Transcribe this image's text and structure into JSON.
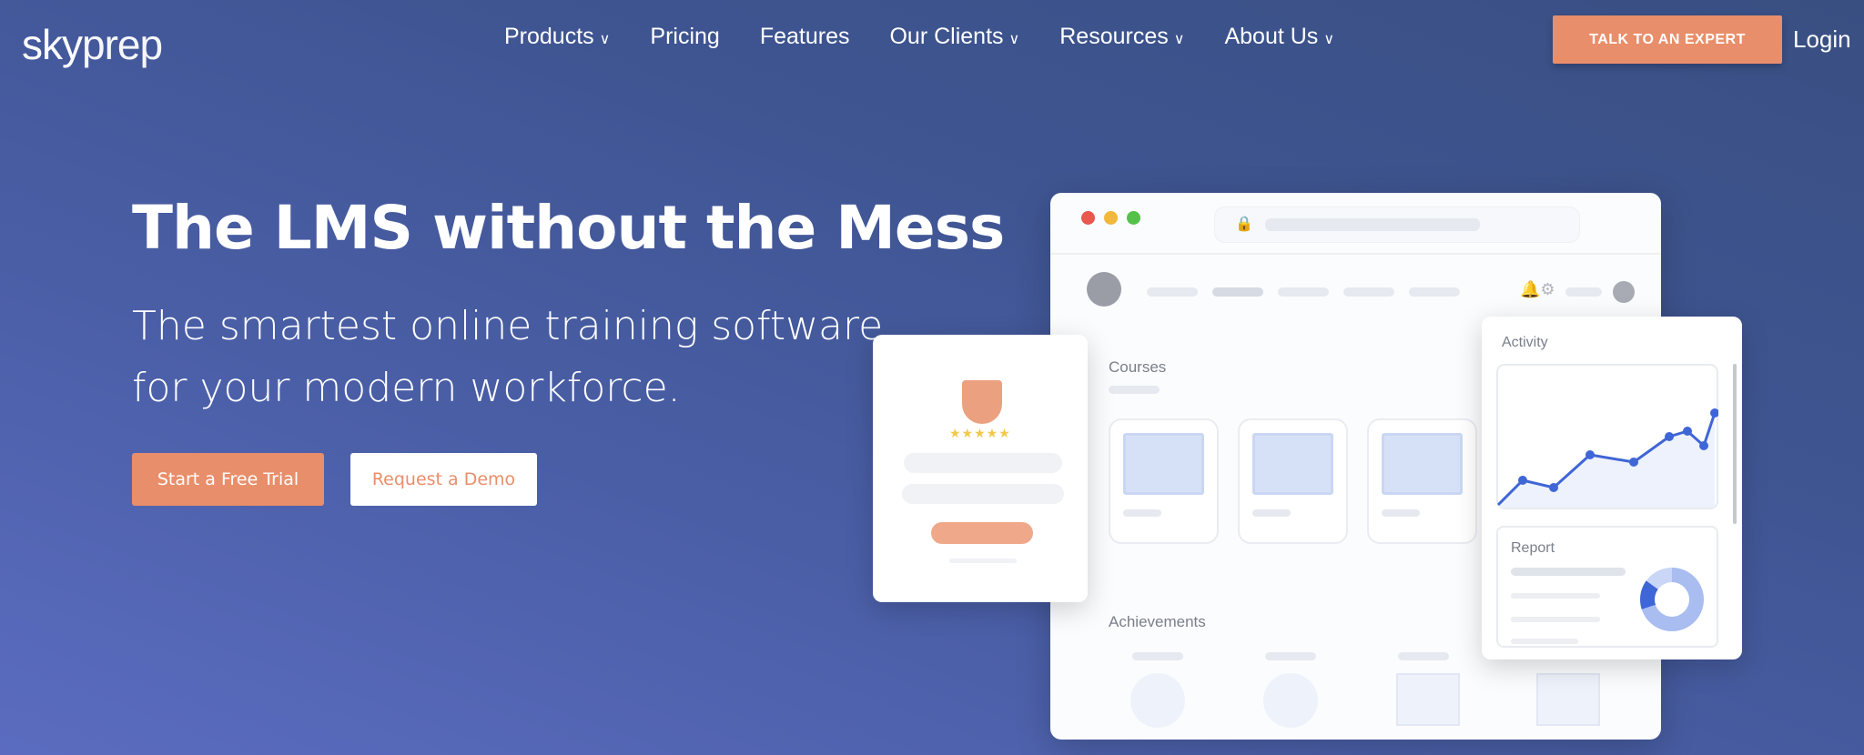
{
  "nav": {
    "logo": "skyprep",
    "items": [
      {
        "label": "Products",
        "dropdown": true
      },
      {
        "label": "Pricing",
        "dropdown": false
      },
      {
        "label": "Features",
        "dropdown": false
      },
      {
        "label": "Our Clients",
        "dropdown": true
      },
      {
        "label": "Resources",
        "dropdown": true
      },
      {
        "label": "About Us",
        "dropdown": true
      }
    ],
    "cta": "TALK TO AN EXPERT",
    "login": "Login"
  },
  "hero": {
    "title": "The LMS without the Mess",
    "subtitle_1": "The smartest online training software",
    "subtitle_2": "for your modern workforce.",
    "primary": "Start a Free Trial",
    "secondary": "Request a Demo"
  },
  "mockup": {
    "courses": "Courses",
    "achievements": "Achievements",
    "activity": "Activity",
    "report": "Report",
    "rating_stars": 5
  },
  "colors": {
    "accent": "#e98e6a",
    "chart": "#3f66d6"
  },
  "chev": "⌄"
}
